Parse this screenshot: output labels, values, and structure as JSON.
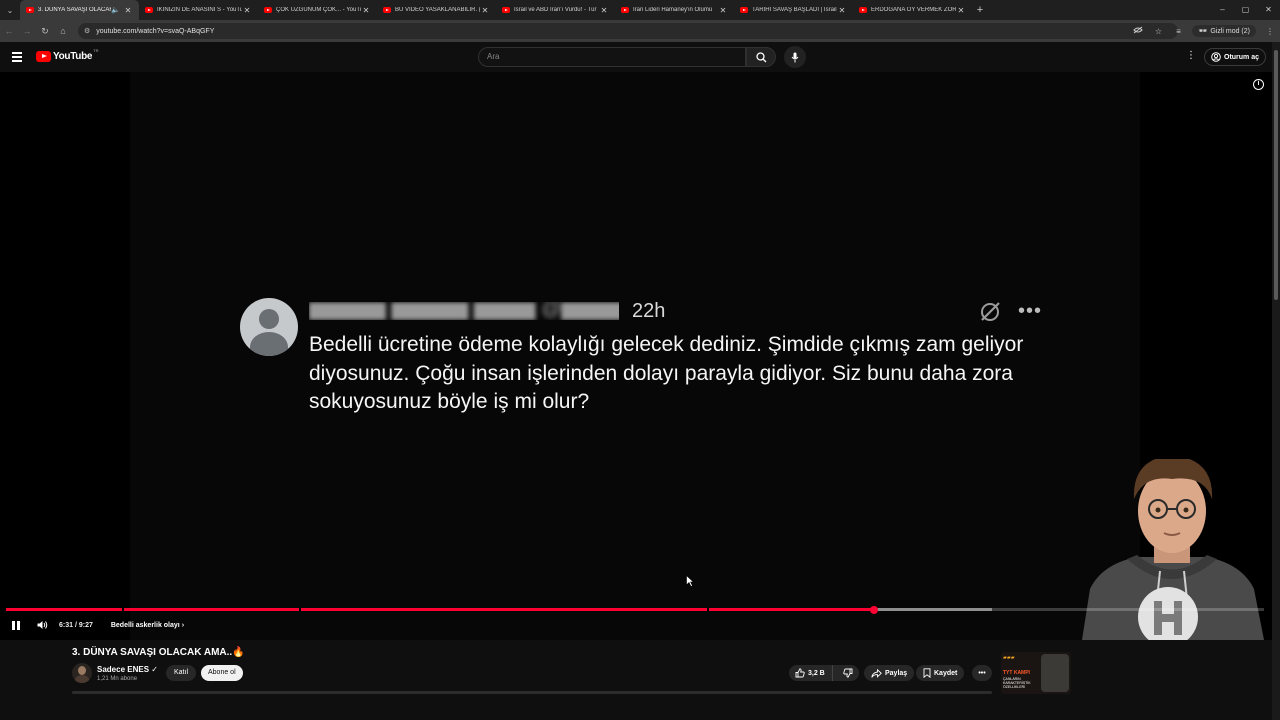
{
  "browser": {
    "tabs": [
      {
        "label": "3. DÜNYA SAVAŞI OLACAK",
        "active": true,
        "audio": true
      },
      {
        "label": "İKİNİZİN DE ANASINI S - YouTube"
      },
      {
        "label": "ÇOK ÜZGÜNÜM ÇOK... - YouTu"
      },
      {
        "label": "BU VİDEO YASAKLANABİLİR. (B"
      },
      {
        "label": "İsrail ve ABD İran'ı Vurdu! - Tür"
      },
      {
        "label": "İran Lideri Hamaney'in Ölümü"
      },
      {
        "label": "TARİHİ SAVAŞ BAŞLADI | İsrail"
      },
      {
        "label": "ERDOĞANA OY VERMEK ZORU"
      }
    ],
    "url": "youtube.com/watch?v=svaQ-ABqGFY",
    "incognito_label": "Gizli mod (2)"
  },
  "youtube": {
    "logo_text": "YouTube",
    "region": "TR",
    "search_placeholder": "Ara",
    "signin_label": "Oturum aç"
  },
  "tweet": {
    "time": "22h",
    "text": "Bedelli ücretine ödeme kolaylığı gelecek dediniz. Şimdide çıkmış zam geliyor diyosunuz. Çoğu insan işlerinden dolayı parayla gidiyor. Siz bunu daha zora sokuyosunuz böyle iş mi olur?"
  },
  "player": {
    "time_display": "6:31 / 9:27",
    "chapter": "Bedelli askerlik olayı",
    "progress_fraction": 0.69,
    "buffered_fraction": 0.784,
    "colors": {
      "played": "#ff0033"
    }
  },
  "video": {
    "title": "3. DÜNYA SAVAŞI OLACAK AMA..🔥",
    "channel": "Sadece ENES",
    "subscribers": "1,21 Mn abone",
    "join_label": "Katıl",
    "subscribe_label": "Abone ol",
    "likes": "3,2 B",
    "share_label": "Paylaş",
    "save_label": "Kaydet"
  },
  "ad": {
    "title": "TYT KAMPI",
    "subtitle": "ÇANLARIN KARAKTERİSTİK ÖZELLİKLERİ"
  },
  "icons": [
    "speaker-icon",
    "close-icon",
    "new-tab-icon",
    "back-icon",
    "forward-icon",
    "reload-icon",
    "home-icon",
    "site-info-icon",
    "eye-off-icon",
    "star-icon",
    "menu-icon",
    "search-icon",
    "mic-icon",
    "more-vert-icon",
    "account-icon",
    "info-icon",
    "grok-icon",
    "more-horiz-icon",
    "pause-icon",
    "volume-icon",
    "chevron-right-icon",
    "like-icon",
    "dislike-icon",
    "share-icon",
    "save-icon"
  ]
}
